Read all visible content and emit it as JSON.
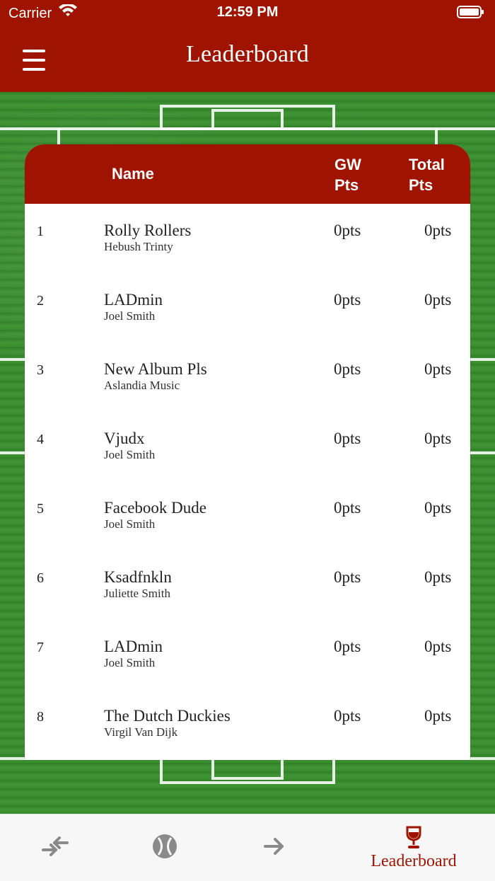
{
  "status_bar": {
    "carrier": "Carrier",
    "time": "12:59 PM"
  },
  "header": {
    "title": "Leaderboard"
  },
  "table": {
    "columns": {
      "name": "Name",
      "gw_pts": "GW\nPts",
      "total_pts": "Total\nPts"
    },
    "rows": [
      {
        "rank": "1",
        "team": "Rolly Rollers",
        "manager": "Hebush Trinty",
        "gw_pts": "0pts",
        "total_pts": "0pts"
      },
      {
        "rank": "2",
        "team": "LADmin",
        "manager": "Joel Smith",
        "gw_pts": "0pts",
        "total_pts": "0pts"
      },
      {
        "rank": "3",
        "team": "New Album Pls",
        "manager": "Aslandia Music",
        "gw_pts": "0pts",
        "total_pts": "0pts"
      },
      {
        "rank": "4",
        "team": "Vjudx",
        "manager": "Joel Smith",
        "gw_pts": "0pts",
        "total_pts": "0pts"
      },
      {
        "rank": "5",
        "team": "Facebook Dude",
        "manager": "Joel Smith",
        "gw_pts": "0pts",
        "total_pts": "0pts"
      },
      {
        "rank": "6",
        "team": "Ksadfnkln",
        "manager": "Juliette Smith",
        "gw_pts": "0pts",
        "total_pts": "0pts"
      },
      {
        "rank": "7",
        "team": "LADmin",
        "manager": "Joel Smith",
        "gw_pts": "0pts",
        "total_pts": "0pts"
      },
      {
        "rank": "8",
        "team": "The Dutch Duckies",
        "manager": "Virgil Van Dijk",
        "gw_pts": "0pts",
        "total_pts": "0pts"
      }
    ]
  },
  "tabbar": {
    "items": [
      {
        "icon": "transfer-arrows-icon",
        "label": ""
      },
      {
        "icon": "ball-icon",
        "label": ""
      },
      {
        "icon": "arrow-right-icon",
        "label": ""
      },
      {
        "icon": "wine-glass-icon",
        "label": "Leaderboard",
        "selected": true
      }
    ]
  },
  "colors": {
    "brand_red": "#9f1400",
    "tab_inactive": "#8a8a8a",
    "tab_background": "#f7f7f7",
    "pitch_green": "#3f9533"
  }
}
